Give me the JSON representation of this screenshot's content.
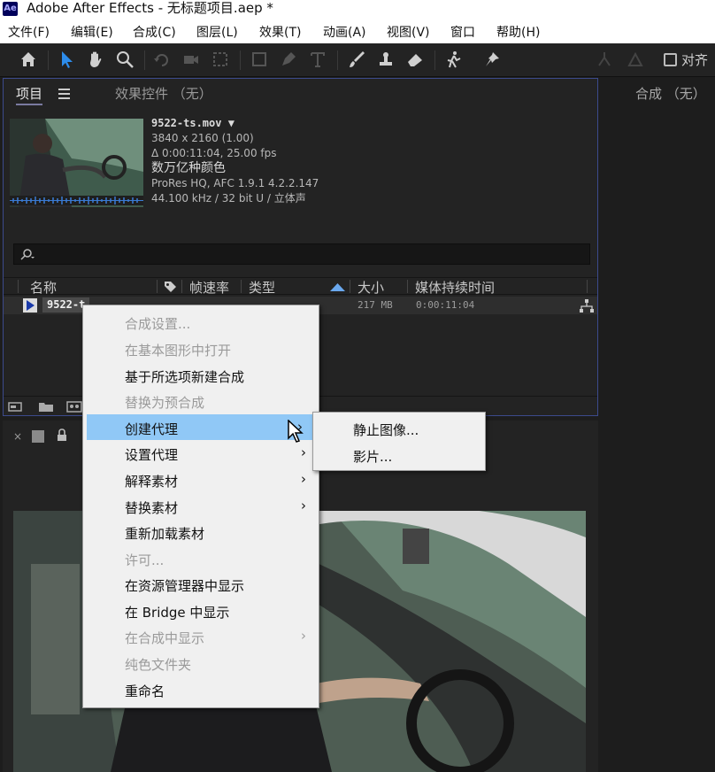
{
  "window": {
    "logo": "Ae",
    "title": "Adobe After Effects - 无标题项目.aep *"
  },
  "menubar": {
    "items": [
      "文件(F)",
      "编辑(E)",
      "合成(C)",
      "图层(L)",
      "效果(T)",
      "动画(A)",
      "视图(V)",
      "窗口",
      "帮助(H)"
    ]
  },
  "toolbar": {
    "icons": [
      "home-icon",
      "selection-arrow-icon",
      "hand-icon",
      "zoom-icon",
      "rotate-icon",
      "camera-icon",
      "pan-behind-icon",
      "rectangle-icon",
      "pen-icon",
      "type-icon",
      "brush-icon",
      "clone-stamp-icon",
      "eraser-icon",
      "roto-brush-icon",
      "puppet-pin-icon"
    ],
    "align_label": "对齐"
  },
  "project_panel": {
    "tab_project": "项目",
    "tab_effects": "效果控件 （无）",
    "footage": {
      "filename": "9522-ts.mov ▼",
      "resolution": "3840 x 2160 (1.00)",
      "duration": "Δ 0:00:11:04, 25.00 fps",
      "colors": "数万亿种颜色",
      "codec": "ProRes HQ, AFC 1.9.1 4.2.2.147",
      "audio": "44.100 kHz / 32 bit U / 立体声"
    },
    "columns": [
      "名称",
      "帧速率",
      "类型",
      "大小",
      "媒体持续时间"
    ],
    "row": {
      "name": "9522-t",
      "size": "217 MB",
      "duration": "0:00:11:04"
    }
  },
  "comp_panel": {
    "label": "合成 （无）"
  },
  "context_menu": {
    "items": [
      {
        "label": "合成设置...",
        "disabled": true,
        "submenu": false
      },
      {
        "label": "在基本图形中打开",
        "disabled": true,
        "submenu": false
      },
      {
        "label": "基于所选项新建合成",
        "disabled": false,
        "submenu": false
      },
      {
        "label": "替换为预合成",
        "disabled": true,
        "submenu": false
      },
      {
        "label": "创建代理",
        "disabled": false,
        "submenu": true,
        "highlighted": true
      },
      {
        "label": "设置代理",
        "disabled": false,
        "submenu": true
      },
      {
        "label": "解释素材",
        "disabled": false,
        "submenu": true
      },
      {
        "label": "替换素材",
        "disabled": false,
        "submenu": true
      },
      {
        "label": "重新加载素材",
        "disabled": false,
        "submenu": false
      },
      {
        "label": "许可...",
        "disabled": true,
        "submenu": false
      },
      {
        "label": "在资源管理器中显示",
        "disabled": false,
        "submenu": false
      },
      {
        "label": "在 Bridge 中显示",
        "disabled": false,
        "submenu": false
      },
      {
        "label": "在合成中显示",
        "disabled": true,
        "submenu": true
      },
      {
        "label": "纯色文件夹",
        "disabled": true,
        "submenu": false
      },
      {
        "label": "重命名",
        "disabled": false,
        "submenu": false
      }
    ]
  },
  "sub_menu": {
    "items": [
      "静止图像...",
      "影片..."
    ]
  },
  "colors": {
    "menu_highlight": "#90c8f6",
    "panel_border": "#3c4a8c",
    "selection_tool": "#2d8ceb"
  }
}
